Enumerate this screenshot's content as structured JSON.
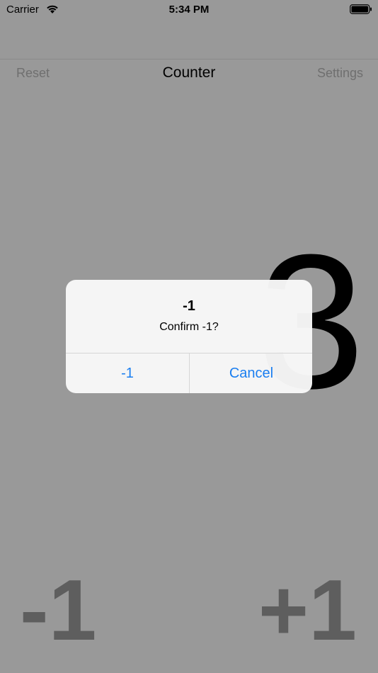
{
  "status_bar": {
    "carrier": "Carrier",
    "time": "5:34 PM",
    "icons": [
      "wifi-icon",
      "battery-icon"
    ]
  },
  "nav": {
    "left_label": "Reset",
    "title": "Counter",
    "right_label": "Settings"
  },
  "counter": {
    "value": "3"
  },
  "controls": {
    "decrement_label": "-1",
    "increment_label": "+1"
  },
  "alert": {
    "title": "-1",
    "message": "Confirm -1?",
    "confirm_label": "-1",
    "cancel_label": "Cancel"
  },
  "colors": {
    "background": "#999999",
    "alert_button": "#1a7ef0",
    "nav_inactive": "#6f6f6f",
    "control_text": "#5e5e5e"
  }
}
